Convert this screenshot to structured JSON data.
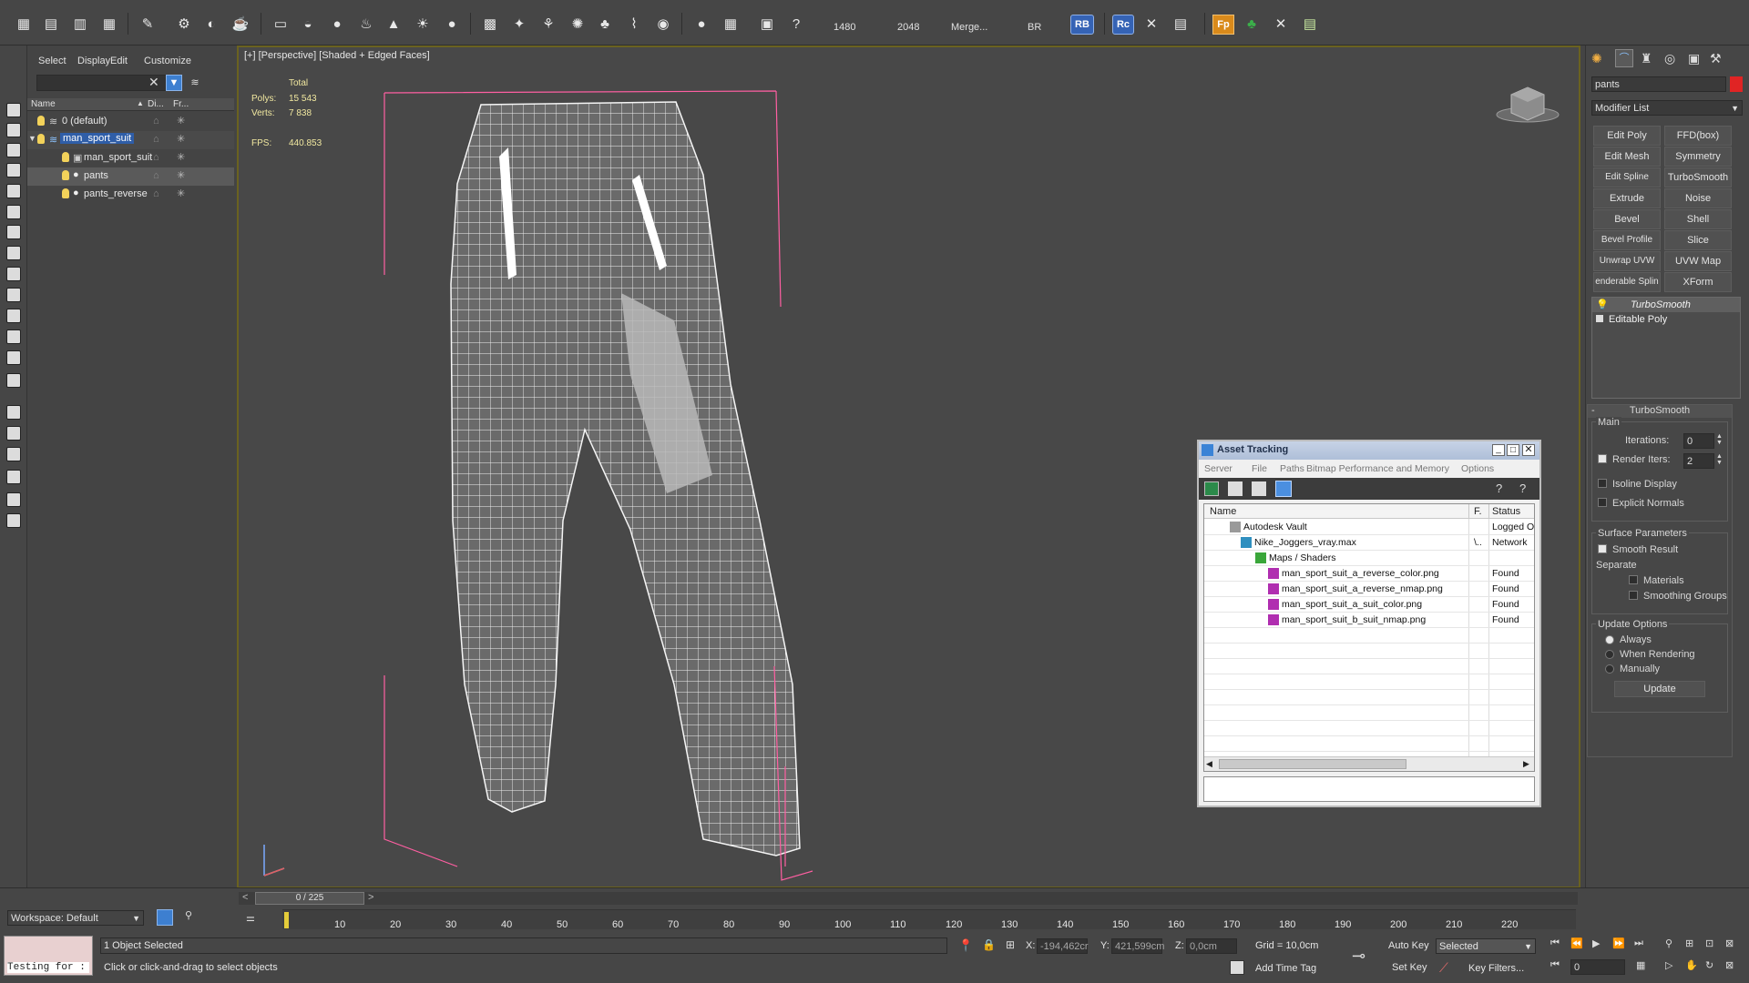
{
  "toolbar": {
    "render_width": "1480",
    "render_height": "2048",
    "merge_label": "Merge...",
    "br_label": "BR",
    "rb_label": "RB",
    "rc_label": "Rc",
    "fp_label": "Fp"
  },
  "explorer": {
    "menu": [
      "Select",
      "Display",
      "Edit",
      "Customize"
    ],
    "col_name": "Name",
    "col_display": "Di...",
    "col_freeze": "Fr...",
    "rows": [
      {
        "label": "0 (default)"
      },
      {
        "label": "man_sport_suit"
      },
      {
        "label": "man_sport_suit"
      },
      {
        "label": "pants"
      },
      {
        "label": "pants_reverse"
      }
    ]
  },
  "viewport": {
    "label": "[+] [Perspective] [Shaded + Edged Faces]",
    "stats_total": "Total",
    "polys_label": "Polys:",
    "polys_value": "15 543",
    "verts_label": "Verts:",
    "verts_value": "7 838",
    "fps_label": "FPS:",
    "fps_value": "440.853"
  },
  "command_panel": {
    "object_name": "pants",
    "modifier_list": "Modifier List",
    "modifier_buttons": [
      "Edit Poly",
      "FFD(box)",
      "Edit Mesh",
      "Symmetry",
      "Edit Spline",
      "TurboSmooth",
      "Extrude",
      "Noise",
      "Bevel",
      "Shell",
      "Bevel Profile",
      "Slice",
      "Unwrap UVW",
      "UVW Map",
      "enderable Splin",
      "XForm"
    ],
    "stack": [
      "TurboSmooth",
      "Editable Poly"
    ],
    "rollout_title": "TurboSmooth",
    "main_label": "Main",
    "iterations_label": "Iterations:",
    "iterations_value": "0",
    "render_iters_label": "Render Iters:",
    "render_iters_value": "2",
    "isoline_label": "Isoline Display",
    "explicit_normals_label": "Explicit Normals",
    "surface_params_label": "Surface Parameters",
    "smooth_result_label": "Smooth Result",
    "separate_label": "Separate",
    "materials_label": "Materials",
    "smoothing_groups_label": "Smoothing Groups",
    "update_options_label": "Update Options",
    "always_label": "Always",
    "when_rendering_label": "When Rendering",
    "manually_label": "Manually",
    "update_button": "Update"
  },
  "asset_tracking": {
    "title": "Asset Tracking",
    "menu": [
      "Server",
      "File",
      "Paths",
      "Bitmap Performance and Memory",
      "Options"
    ],
    "col_name": "Name",
    "col_f": "F.",
    "col_status": "Status",
    "rows": [
      {
        "name": "Autodesk Vault",
        "f": "",
        "status": "Logged O"
      },
      {
        "name": "Nike_Joggers_vray.max",
        "f": "\\..",
        "status": "Network"
      },
      {
        "name": "Maps / Shaders",
        "f": "",
        "status": ""
      },
      {
        "name": "man_sport_suit_a_reverse_color.png",
        "f": "",
        "status": "Found"
      },
      {
        "name": "man_sport_suit_a_reverse_nmap.png",
        "f": "",
        "status": "Found"
      },
      {
        "name": "man_sport_suit_a_suit_color.png",
        "f": "",
        "status": "Found"
      },
      {
        "name": "man_sport_suit_b_suit_nmap.png",
        "f": "",
        "status": "Found"
      }
    ]
  },
  "timeline": {
    "frame_counter": "0 / 225",
    "ticks": [
      "10",
      "20",
      "30",
      "40",
      "50",
      "60",
      "70",
      "80",
      "90",
      "100",
      "110",
      "120",
      "130",
      "140",
      "150",
      "160",
      "170",
      "180",
      "190",
      "200",
      "210",
      "220"
    ]
  },
  "status": {
    "workspace": "Workspace: Default",
    "script_text": "Testing for :",
    "selected": "1 Object Selected",
    "prompt": "Click or click-and-drag to select objects",
    "x_label": "X:",
    "x_value": "-194,462cr",
    "y_label": "Y:",
    "y_value": "421,599cm",
    "z_label": "Z:",
    "z_value": "0,0cm",
    "grid": "Grid = 10,0cm",
    "add_time_tag": "Add Time Tag",
    "auto_key": "Auto Key",
    "set_key": "Set Key",
    "selected_dropdown": "Selected",
    "key_filters": "Key Filters...",
    "frame_value": "0"
  }
}
